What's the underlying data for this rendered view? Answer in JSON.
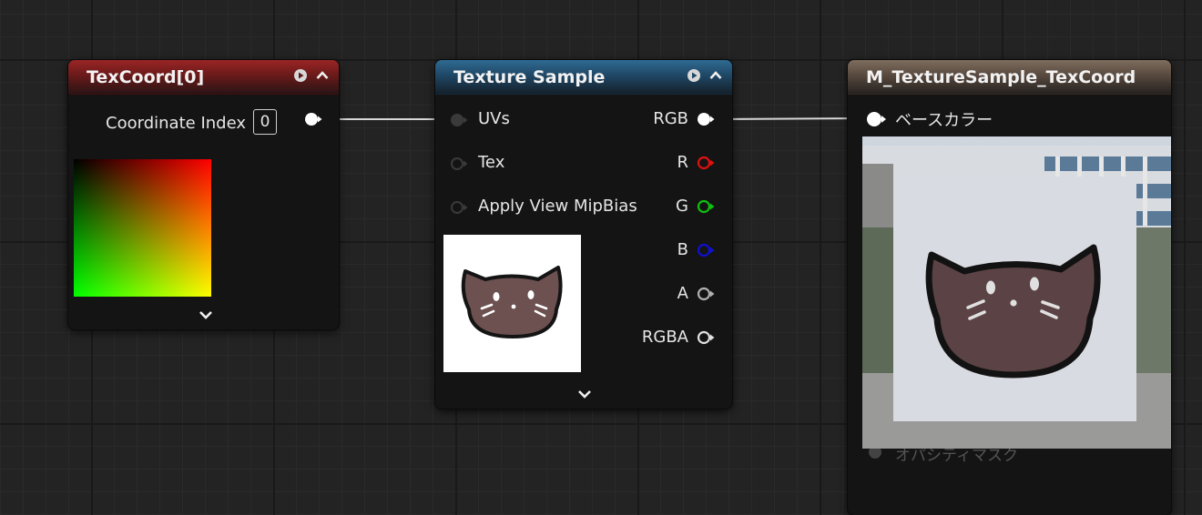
{
  "nodes": {
    "texcoord": {
      "title": "TexCoord[0]",
      "coordinate_index_label": "Coordinate Index",
      "coordinate_index_value": "0"
    },
    "texture_sample": {
      "title": "Texture Sample",
      "inputs": [
        "UVs",
        "Tex",
        "Apply View MipBias"
      ],
      "outputs": [
        "RGB",
        "R",
        "G",
        "B",
        "A",
        "RGBA"
      ]
    },
    "material": {
      "title": "M_TextureSample_TexCoord",
      "base_color_label": "ベースカラー",
      "obscured_label": "オパシティマスク"
    }
  },
  "colors": {
    "texcoord_header": "#9a2525",
    "texture_header": "#2f6a92",
    "material_header": "#7e6d5e",
    "pin_white": "#ffffff",
    "pin_red": "#e01010",
    "pin_green": "#10c010",
    "pin_blue": "#1010d0",
    "pin_gray": "#b0b0b0"
  },
  "icons": [
    "preview-play-icon",
    "collapse-caret-icon",
    "expand-chevron-icon",
    "cat-face-icon"
  ]
}
